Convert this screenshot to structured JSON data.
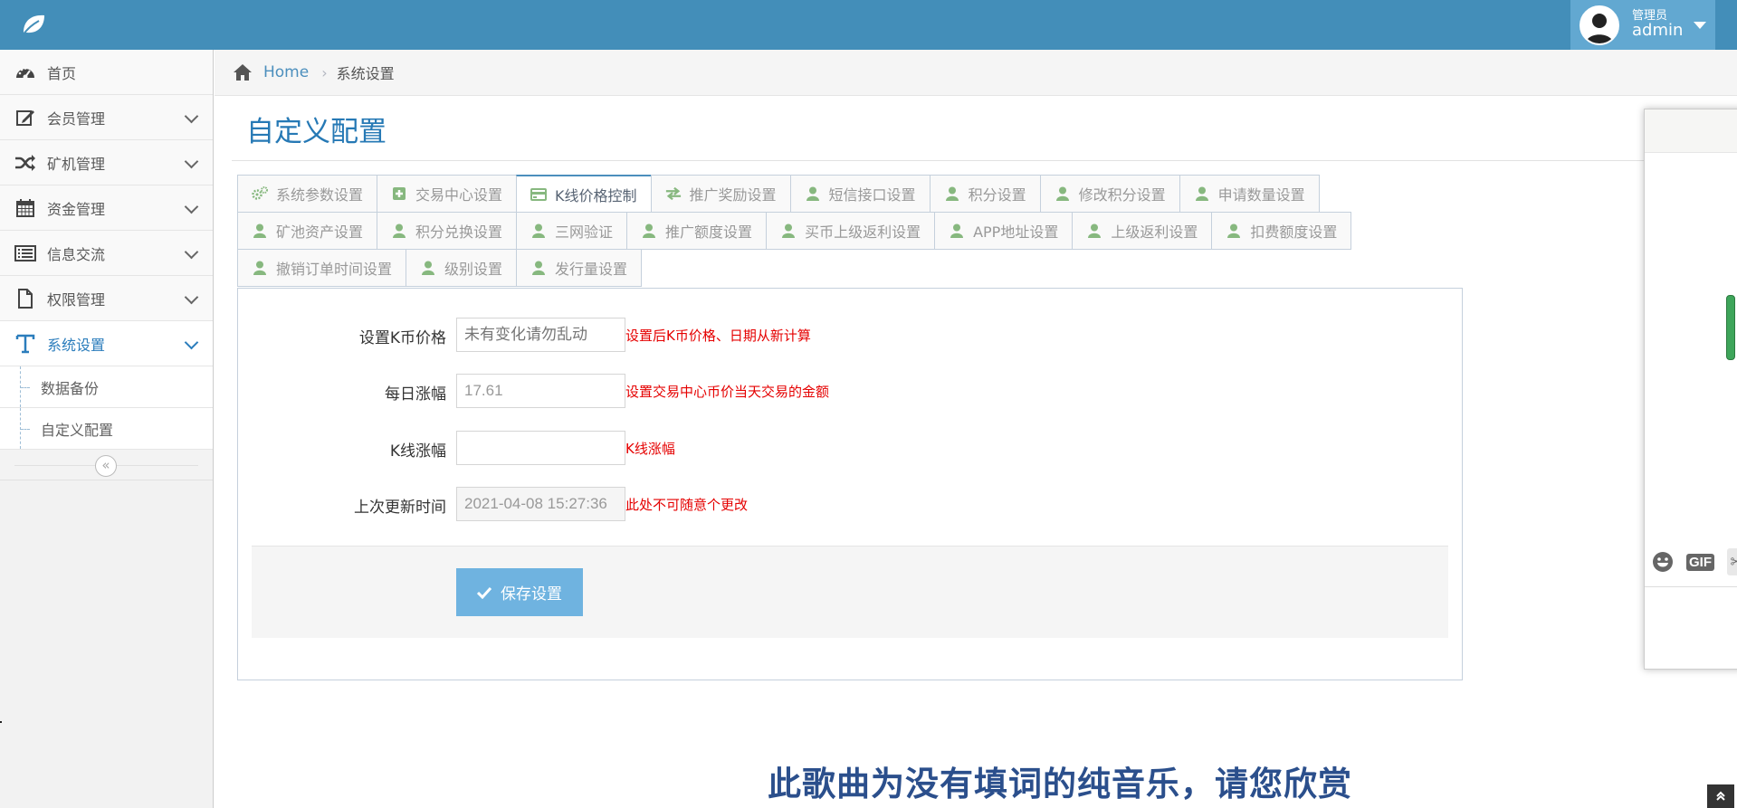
{
  "header": {
    "user_role": "管理员",
    "user_name": "admin"
  },
  "sidebar": {
    "items": [
      {
        "label": "首页",
        "icon": "dashboard-icon",
        "has_submenu": false
      },
      {
        "label": "会员管理",
        "icon": "edit-icon",
        "has_submenu": true
      },
      {
        "label": "矿机管理",
        "icon": "shuffle-icon",
        "has_submenu": true
      },
      {
        "label": "资金管理",
        "icon": "calendar-icon",
        "has_submenu": true
      },
      {
        "label": "信息交流",
        "icon": "list-icon",
        "has_submenu": true
      },
      {
        "label": "权限管理",
        "icon": "file-icon",
        "has_submenu": true
      },
      {
        "label": "系统设置",
        "icon": "text-icon",
        "has_submenu": true,
        "active": true
      }
    ],
    "subitems": [
      {
        "label": "数据备份"
      },
      {
        "label": "自定义配置"
      }
    ],
    "collapse_glyph": "«"
  },
  "breadcrumb": {
    "home": "Home",
    "current": "系统设置"
  },
  "page": {
    "title": "自定义配置"
  },
  "tabs": {
    "row1": [
      {
        "label": "系统参数设置",
        "icon": "cogs-icon"
      },
      {
        "label": "交易中心设置",
        "icon": "plus-square-icon"
      },
      {
        "label": "K线价格控制",
        "icon": "credit-card-icon",
        "active": true
      },
      {
        "label": "推广奖励设置",
        "icon": "exchange-icon"
      },
      {
        "label": "短信接口设置",
        "icon": "user-icon"
      },
      {
        "label": "积分设置",
        "icon": "user-icon"
      },
      {
        "label": "修改积分设置",
        "icon": "user-icon"
      },
      {
        "label": "申请数量设置",
        "icon": "user-icon"
      }
    ],
    "row2": [
      {
        "label": "矿池资产设置",
        "icon": "user-icon"
      },
      {
        "label": "积分兑换设置",
        "icon": "user-icon"
      },
      {
        "label": "三网验证",
        "icon": "user-icon"
      },
      {
        "label": "推广额度设置",
        "icon": "user-icon"
      },
      {
        "label": "买币上级返利设置",
        "icon": "user-icon"
      },
      {
        "label": "APP地址设置",
        "icon": "user-icon"
      },
      {
        "label": "上级返利设置",
        "icon": "user-icon"
      },
      {
        "label": "扣费额度设置",
        "icon": "user-icon"
      }
    ],
    "row3": [
      {
        "label": "撤销订单时间设置",
        "icon": "user-icon"
      },
      {
        "label": "级别设置",
        "icon": "user-icon"
      },
      {
        "label": "发行量设置",
        "icon": "user-icon"
      }
    ]
  },
  "form": {
    "fields": [
      {
        "label": "设置K币价格",
        "value": "",
        "placeholder": "未有变化请勿乱动",
        "hint": "设置后K币价格、日期从新计算",
        "readonly": false
      },
      {
        "label": "每日涨幅",
        "value": "17.61",
        "placeholder": "",
        "hint": "设置交易中心币价当天交易的金额",
        "readonly": false
      },
      {
        "label": "K线涨幅",
        "value": "",
        "placeholder": "",
        "hint": "K线涨幅",
        "readonly": false
      },
      {
        "label": "上次更新时间",
        "value": "2021-04-08 15:27:36",
        "placeholder": "",
        "hint": "此处不可随意个更改",
        "readonly": true
      }
    ],
    "save_label": "保存设置"
  },
  "chat": {
    "gif_label": "GIF"
  },
  "overlay": {
    "lyrics": "此歌曲为没有填词的纯音乐，请您欣赏"
  },
  "colors": {
    "header_bg": "#438eb9",
    "user_area_bg": "#62a8d1",
    "title_blue": "#2679b5",
    "hint_red": "#e50000",
    "tab_icon_green": "#87b87f",
    "save_button": "#6fb3e0"
  }
}
